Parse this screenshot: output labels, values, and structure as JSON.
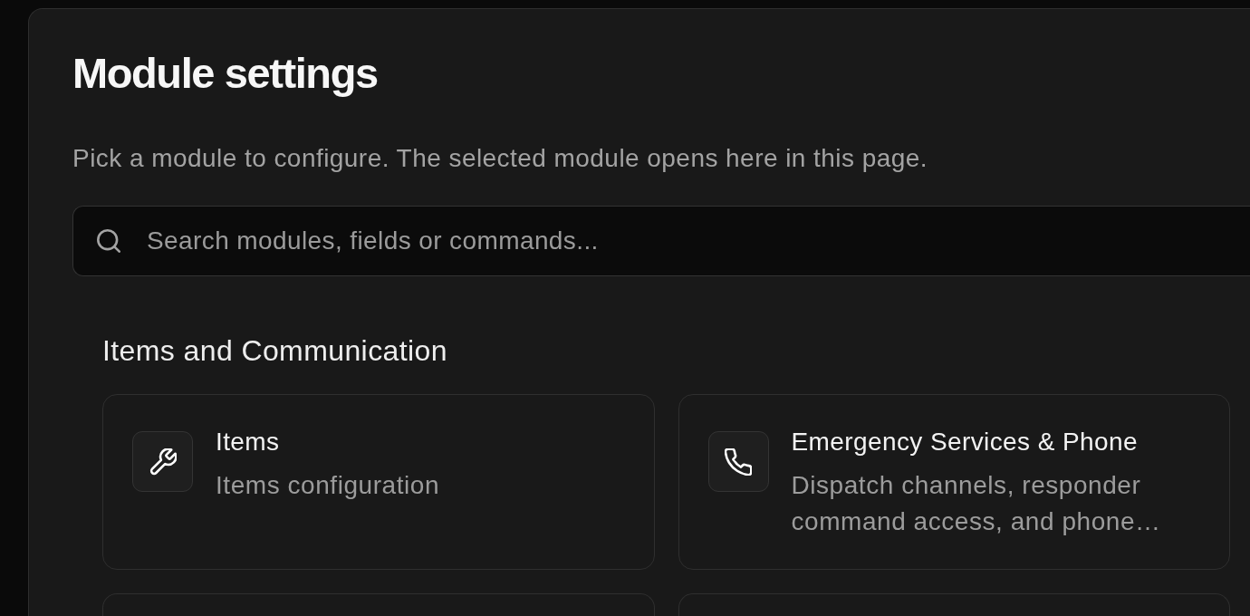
{
  "page": {
    "title": "Module settings",
    "subtitle": "Pick a module to configure. The selected module opens here in this page."
  },
  "search": {
    "placeholder": "Search modules, fields or commands..."
  },
  "sections": [
    {
      "heading": "Items and Communication",
      "modules": [
        {
          "kind": "full",
          "title": "Items",
          "description": "Items configuration"
        },
        {
          "kind": "full",
          "title": "Emergency Services & Phone",
          "description": "Dispatch channels, responder command access, and phone…"
        },
        {
          "kind": "cut_off"
        },
        {
          "kind": "cut_off"
        }
      ]
    }
  ]
}
